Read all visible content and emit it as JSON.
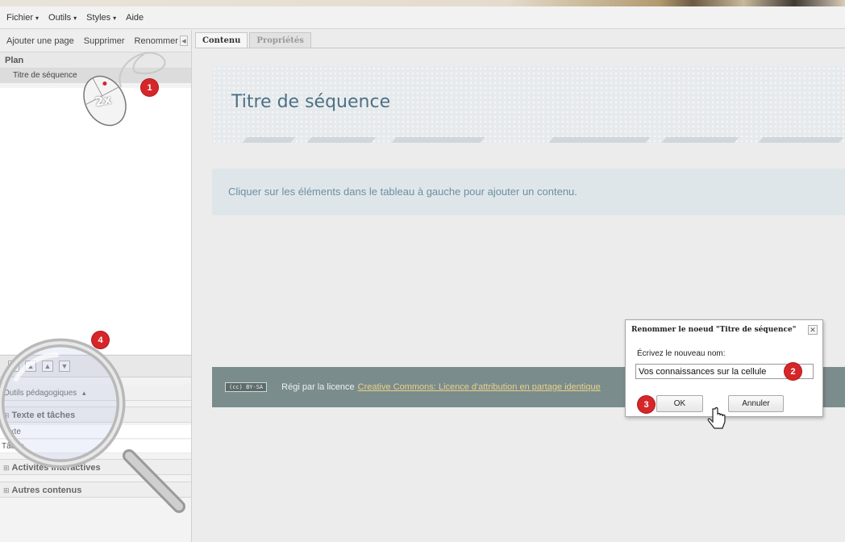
{
  "menubar": {
    "items": [
      {
        "label": "Fichier",
        "has_dropdown": true
      },
      {
        "label": "Outils",
        "has_dropdown": true
      },
      {
        "label": "Styles",
        "has_dropdown": true
      },
      {
        "label": "Aide",
        "has_dropdown": false
      }
    ],
    "caret": "▾"
  },
  "left_panel": {
    "toolbar": {
      "add_page": "Ajouter une page",
      "delete": "Supprimer",
      "rename": "Renommer",
      "collapse_glyph": "◀"
    },
    "plan_header": "Plan",
    "tree": [
      {
        "label": "Titre de séquence"
      }
    ],
    "move_buttons": [
      {
        "glyph": "⤒",
        "icon": "move-top-icon"
      },
      {
        "glyph": "▲",
        "icon": "move-up-icon"
      },
      {
        "glyph": "▲",
        "icon": "move-up-alt-icon"
      },
      {
        "glyph": "▼",
        "icon": "move-down-icon"
      }
    ],
    "tools_header": "Outils pédagogiques",
    "tools_caret": "▴",
    "categories": {
      "texte_taches": "Texte et tâches",
      "activites": "Activités interactives",
      "autres": "Autres contenus"
    },
    "tools": [
      "Texte",
      "Tâche"
    ],
    "plus_glyph": "⊞"
  },
  "tabs": [
    {
      "label": "Contenu",
      "active": true
    },
    {
      "label": "Propriétés",
      "active": false
    }
  ],
  "content": {
    "title": "Titre de séquence",
    "info": "Cliquer sur les éléments dans le tableau à gauche pour ajouter un contenu.",
    "license_badge": "(cc) BY-SA",
    "license_text": "Régi par la licence",
    "license_link": "Creative Commons: Licence d'attribution en partage identique"
  },
  "dialog": {
    "title": "Renommer le noeud \"Titre de séquence\"",
    "close": "✕",
    "label": "Écrivez le nouveau nom:",
    "input_value": "Vos connaissances sur la cellule",
    "ok": "OK",
    "cancel": "Annuler"
  },
  "annotations": {
    "badge_1": "1",
    "badge_2": "2",
    "badge_3": "3",
    "badge_4": "4",
    "mouse_label": "2x"
  },
  "colors": {
    "badge_red": "#d6262a",
    "title_blue": "#4c7186",
    "license_bar": "#7b8c8c",
    "info_box": "#dfe6ea"
  }
}
